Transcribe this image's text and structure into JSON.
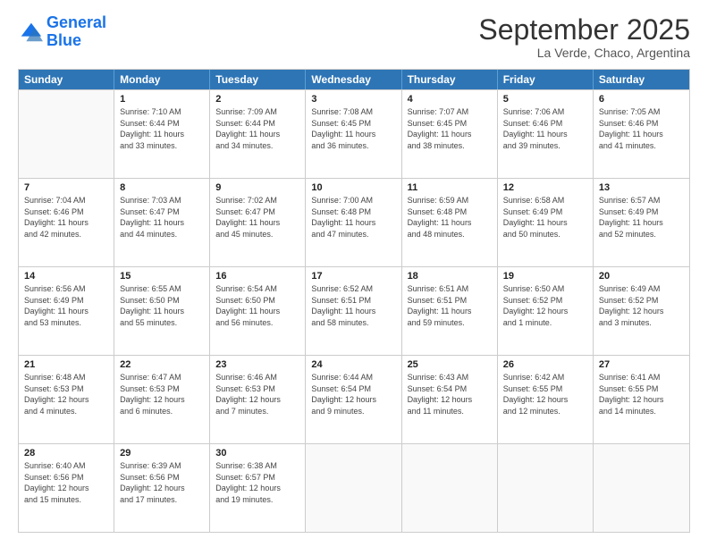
{
  "logo": {
    "line1": "General",
    "line2": "Blue"
  },
  "title": "September 2025",
  "location": "La Verde, Chaco, Argentina",
  "days_header": [
    "Sunday",
    "Monday",
    "Tuesday",
    "Wednesday",
    "Thursday",
    "Friday",
    "Saturday"
  ],
  "weeks": [
    [
      {
        "num": "",
        "info": ""
      },
      {
        "num": "1",
        "info": "Sunrise: 7:10 AM\nSunset: 6:44 PM\nDaylight: 11 hours\nand 33 minutes."
      },
      {
        "num": "2",
        "info": "Sunrise: 7:09 AM\nSunset: 6:44 PM\nDaylight: 11 hours\nand 34 minutes."
      },
      {
        "num": "3",
        "info": "Sunrise: 7:08 AM\nSunset: 6:45 PM\nDaylight: 11 hours\nand 36 minutes."
      },
      {
        "num": "4",
        "info": "Sunrise: 7:07 AM\nSunset: 6:45 PM\nDaylight: 11 hours\nand 38 minutes."
      },
      {
        "num": "5",
        "info": "Sunrise: 7:06 AM\nSunset: 6:46 PM\nDaylight: 11 hours\nand 39 minutes."
      },
      {
        "num": "6",
        "info": "Sunrise: 7:05 AM\nSunset: 6:46 PM\nDaylight: 11 hours\nand 41 minutes."
      }
    ],
    [
      {
        "num": "7",
        "info": "Sunrise: 7:04 AM\nSunset: 6:46 PM\nDaylight: 11 hours\nand 42 minutes."
      },
      {
        "num": "8",
        "info": "Sunrise: 7:03 AM\nSunset: 6:47 PM\nDaylight: 11 hours\nand 44 minutes."
      },
      {
        "num": "9",
        "info": "Sunrise: 7:02 AM\nSunset: 6:47 PM\nDaylight: 11 hours\nand 45 minutes."
      },
      {
        "num": "10",
        "info": "Sunrise: 7:00 AM\nSunset: 6:48 PM\nDaylight: 11 hours\nand 47 minutes."
      },
      {
        "num": "11",
        "info": "Sunrise: 6:59 AM\nSunset: 6:48 PM\nDaylight: 11 hours\nand 48 minutes."
      },
      {
        "num": "12",
        "info": "Sunrise: 6:58 AM\nSunset: 6:49 PM\nDaylight: 11 hours\nand 50 minutes."
      },
      {
        "num": "13",
        "info": "Sunrise: 6:57 AM\nSunset: 6:49 PM\nDaylight: 11 hours\nand 52 minutes."
      }
    ],
    [
      {
        "num": "14",
        "info": "Sunrise: 6:56 AM\nSunset: 6:49 PM\nDaylight: 11 hours\nand 53 minutes."
      },
      {
        "num": "15",
        "info": "Sunrise: 6:55 AM\nSunset: 6:50 PM\nDaylight: 11 hours\nand 55 minutes."
      },
      {
        "num": "16",
        "info": "Sunrise: 6:54 AM\nSunset: 6:50 PM\nDaylight: 11 hours\nand 56 minutes."
      },
      {
        "num": "17",
        "info": "Sunrise: 6:52 AM\nSunset: 6:51 PM\nDaylight: 11 hours\nand 58 minutes."
      },
      {
        "num": "18",
        "info": "Sunrise: 6:51 AM\nSunset: 6:51 PM\nDaylight: 11 hours\nand 59 minutes."
      },
      {
        "num": "19",
        "info": "Sunrise: 6:50 AM\nSunset: 6:52 PM\nDaylight: 12 hours\nand 1 minute."
      },
      {
        "num": "20",
        "info": "Sunrise: 6:49 AM\nSunset: 6:52 PM\nDaylight: 12 hours\nand 3 minutes."
      }
    ],
    [
      {
        "num": "21",
        "info": "Sunrise: 6:48 AM\nSunset: 6:53 PM\nDaylight: 12 hours\nand 4 minutes."
      },
      {
        "num": "22",
        "info": "Sunrise: 6:47 AM\nSunset: 6:53 PM\nDaylight: 12 hours\nand 6 minutes."
      },
      {
        "num": "23",
        "info": "Sunrise: 6:46 AM\nSunset: 6:53 PM\nDaylight: 12 hours\nand 7 minutes."
      },
      {
        "num": "24",
        "info": "Sunrise: 6:44 AM\nSunset: 6:54 PM\nDaylight: 12 hours\nand 9 minutes."
      },
      {
        "num": "25",
        "info": "Sunrise: 6:43 AM\nSunset: 6:54 PM\nDaylight: 12 hours\nand 11 minutes."
      },
      {
        "num": "26",
        "info": "Sunrise: 6:42 AM\nSunset: 6:55 PM\nDaylight: 12 hours\nand 12 minutes."
      },
      {
        "num": "27",
        "info": "Sunrise: 6:41 AM\nSunset: 6:55 PM\nDaylight: 12 hours\nand 14 minutes."
      }
    ],
    [
      {
        "num": "28",
        "info": "Sunrise: 6:40 AM\nSunset: 6:56 PM\nDaylight: 12 hours\nand 15 minutes."
      },
      {
        "num": "29",
        "info": "Sunrise: 6:39 AM\nSunset: 6:56 PM\nDaylight: 12 hours\nand 17 minutes."
      },
      {
        "num": "30",
        "info": "Sunrise: 6:38 AM\nSunset: 6:57 PM\nDaylight: 12 hours\nand 19 minutes."
      },
      {
        "num": "",
        "info": ""
      },
      {
        "num": "",
        "info": ""
      },
      {
        "num": "",
        "info": ""
      },
      {
        "num": "",
        "info": ""
      }
    ]
  ]
}
